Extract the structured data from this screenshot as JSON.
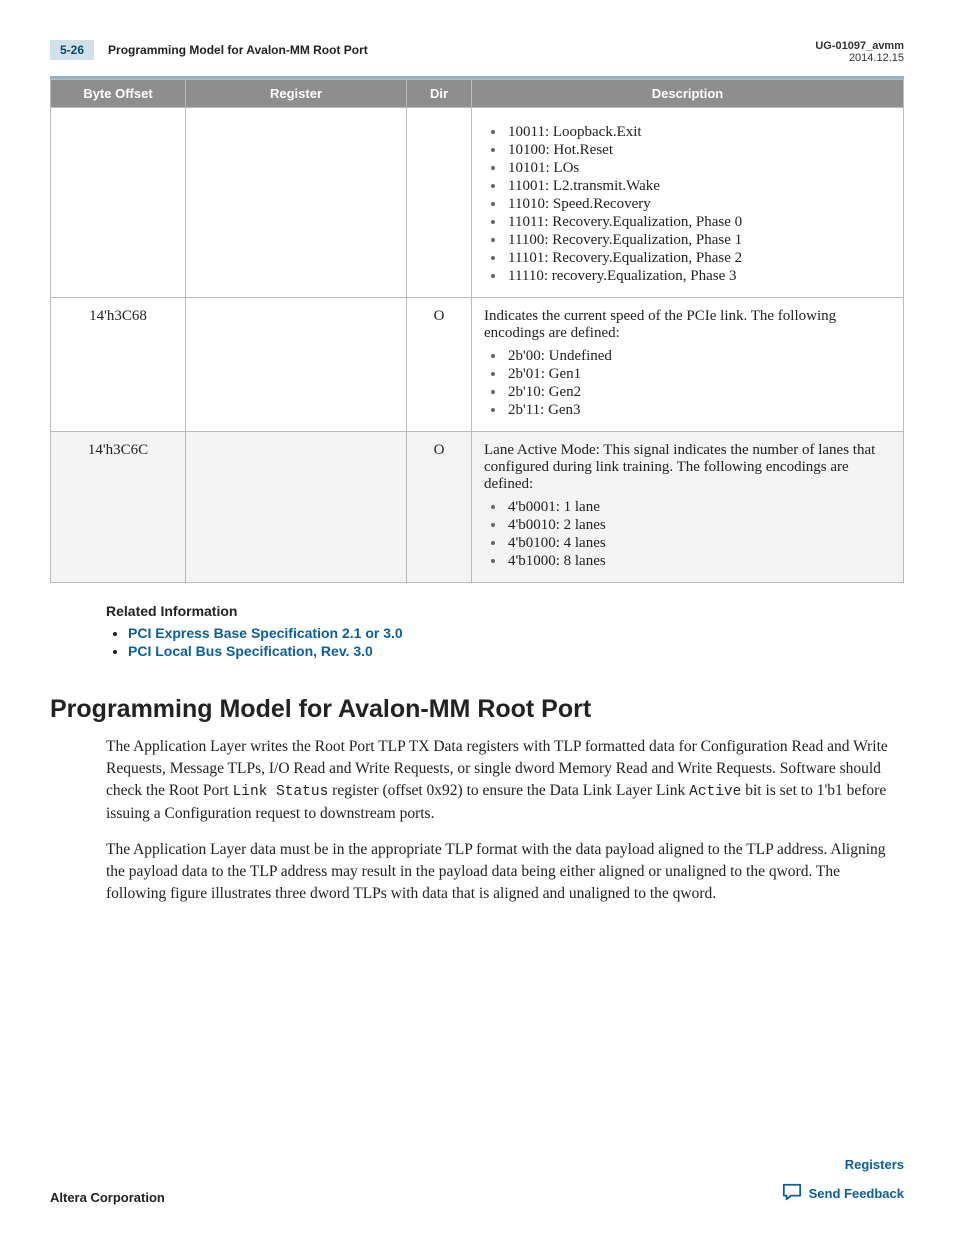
{
  "header": {
    "page_num": "5-26",
    "page_title": "Programming Model for Avalon-MM Root Port",
    "doc_id": "UG-01097_avmm",
    "date": "2014.12.15"
  },
  "table": {
    "headers": [
      "Byte Offset",
      "Register",
      "Dir",
      "Description"
    ],
    "row0": {
      "items": [
        "10011: Loopback.Exit",
        "10100: Hot.Reset",
        "10101: LOs",
        "11001: L2.transmit.Wake",
        "11010: Speed.Recovery",
        "11011: Recovery.Equalization, Phase 0",
        "11100: Recovery.Equalization, Phase 1",
        "11101: Recovery.Equalization, Phase 2",
        "11110: recovery.Equalization, Phase 3"
      ]
    },
    "row1": {
      "byte": "14'h3C68",
      "dir": "O",
      "desc_intro": "Indicates the current speed of the PCIe link. The following encodings are defined:",
      "items": [
        "2b'00: Undefined",
        "2b'01: Gen1",
        "2b'10: Gen2",
        "2b'11: Gen3"
      ]
    },
    "row2": {
      "byte": "14'h3C6C",
      "dir": "O",
      "desc_intro": "Lane Active Mode: This signal indicates the number of lanes that configured during link training. The following encodings are defined:",
      "items": [
        "4'b0001: 1 lane",
        "4'b0010: 2 lanes",
        "4'b0100: 4 lanes",
        "4'b1000: 8 lanes"
      ]
    }
  },
  "related": {
    "heading": "Related Information",
    "links": [
      "PCI Express Base Specification 2.1 or 3.0",
      "PCI Local Bus Specification, Rev. 3.0"
    ]
  },
  "section": {
    "title": "Programming Model for Avalon-MM Root Port",
    "para1_a": "The Application Layer writes the Root Port TLP TX Data registers with TLP formatted data for Configu­ration Read and Write Requests, Message TLPs, I/O Read and Write Requests, or single dword Memory Read and Write Requests. Software should check the Root Port ",
    "para1_mono1": "Link Status",
    "para1_b": " register (offset 0x92) to ensure the Data Link Layer Link ",
    "para1_mono2": "Active",
    "para1_c": " bit is set to 1'b1 before issuing a Configuration request to downstream ports.",
    "para2": "The Application Layer data must be in the appropriate TLP format with the data payload aligned to the TLP address. Aligning the payload data to the TLP address may result in the payload data being either aligned or unaligned to the qword. The following figure illustrates three dword TLPs with data that is aligned and unaligned to the qword."
  },
  "footer": {
    "left": "Altera Corporation",
    "right_link": "Registers",
    "feedback": "Send Feedback"
  }
}
